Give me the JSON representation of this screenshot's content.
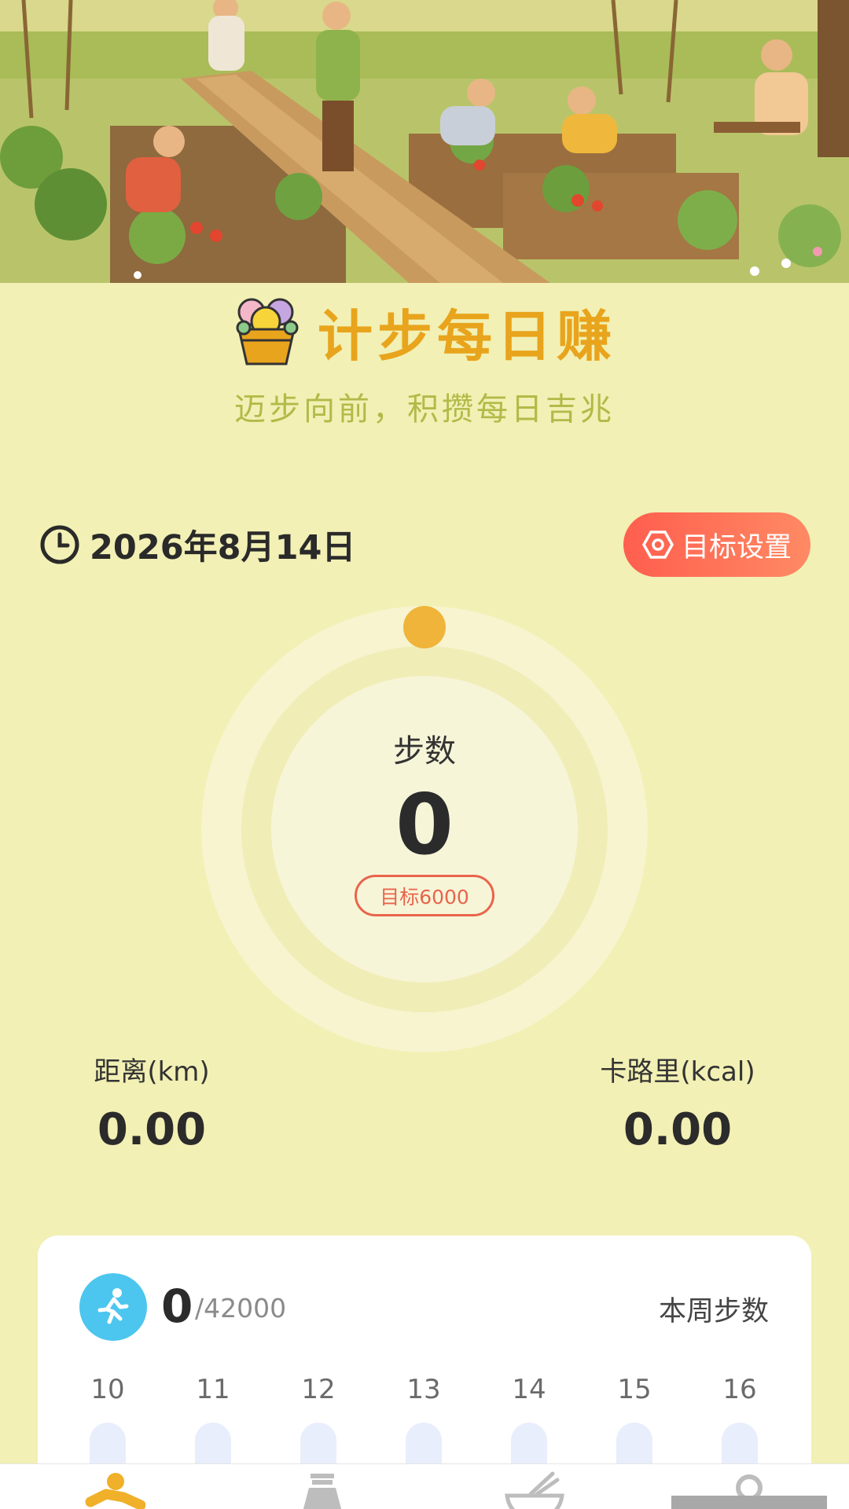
{
  "app": {
    "title": "计步每日赚",
    "slogan": "迈步向前，积攒每日吉兆"
  },
  "header": {
    "date": "2026年8月14日",
    "goal_button_label": "目标设置"
  },
  "steps": {
    "label": "步数",
    "value": "0",
    "target_label": "目标6000",
    "progress": 0
  },
  "metrics": {
    "distance": {
      "label": "距离(km)",
      "value": "0.00"
    },
    "calories": {
      "label": "卡路里(kcal)",
      "value": "0.00"
    }
  },
  "week": {
    "count": "0",
    "goal": "/42000",
    "label": "本周步数",
    "days": [
      {
        "day": "10",
        "steps": 0
      },
      {
        "day": "11",
        "steps": 0
      },
      {
        "day": "12",
        "steps": 0
      },
      {
        "day": "13",
        "steps": 0
      },
      {
        "day": "14",
        "steps": 0
      },
      {
        "day": "15",
        "steps": 0
      },
      {
        "day": "16",
        "steps": 0
      }
    ]
  },
  "nav": {
    "items": [
      {
        "icon": "runner-icon",
        "active": true
      },
      {
        "icon": "bottle-icon",
        "active": false
      },
      {
        "icon": "bowl-icon",
        "active": false
      },
      {
        "icon": "profile-icon",
        "active": false
      }
    ]
  },
  "colors": {
    "background": "#F2F0B4",
    "title": "#E8A41C",
    "slogan": "#B2BA48",
    "accent_red": "#FF5E4E",
    "ring_dot": "#F0B43A",
    "run_avatar": "#4CC6EE"
  }
}
